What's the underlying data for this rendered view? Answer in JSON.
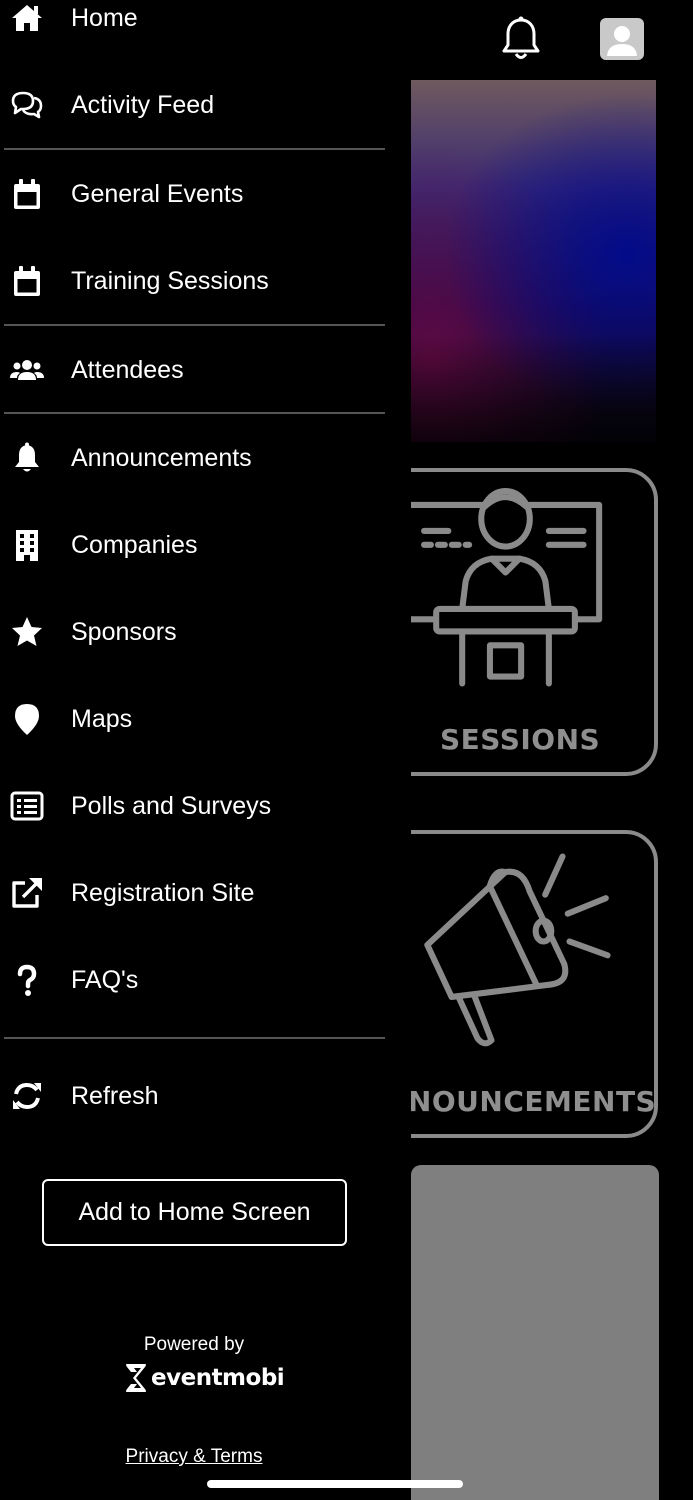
{
  "background": {
    "cards": {
      "sessions_label": "SESSIONS",
      "announcements_label": "NNOUNCEMENTS"
    }
  },
  "drawer": {
    "items": [
      {
        "label": "Home",
        "icon": "home-icon"
      },
      {
        "label": "Activity Feed",
        "icon": "chat-bubbles-icon"
      },
      {
        "label": "General Events",
        "icon": "calendar-icon"
      },
      {
        "label": "Training Sessions",
        "icon": "calendar-icon"
      },
      {
        "label": "Attendees",
        "icon": "users-icon"
      },
      {
        "label": "Announcements",
        "icon": "bell-icon"
      },
      {
        "label": "Companies",
        "icon": "building-icon"
      },
      {
        "label": "Sponsors",
        "icon": "star-icon"
      },
      {
        "label": "Maps",
        "icon": "map-pin-icon"
      },
      {
        "label": "Polls and Surveys",
        "icon": "list-icon"
      },
      {
        "label": "Registration Site",
        "icon": "external-link-icon"
      },
      {
        "label": "FAQ's",
        "icon": "question-icon"
      },
      {
        "label": "Refresh",
        "icon": "refresh-icon"
      }
    ],
    "add_home_label": "Add to Home Screen",
    "powered_by": "Powered by",
    "brand": "eventmobi",
    "privacy_label": "Privacy & Terms"
  },
  "colors": {
    "background": "#000000",
    "text": "#ffffff",
    "divider": "#555555",
    "card_outline": "#8a8a8a",
    "overlay_tile": "#7f7f7f"
  }
}
